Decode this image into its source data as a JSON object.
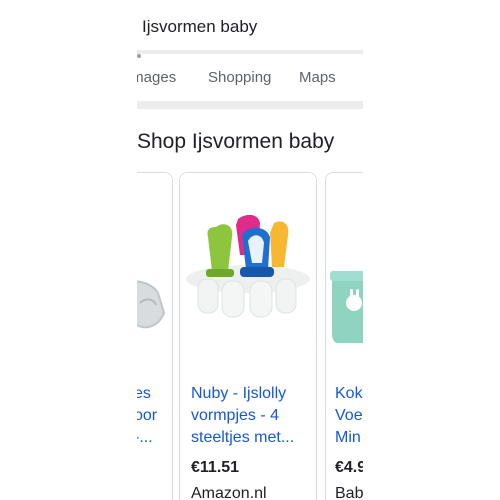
{
  "search": {
    "query": "Ijsvormen baby"
  },
  "tabs": [
    {
      "label": "Images"
    },
    {
      "label": "Shopping"
    },
    {
      "label": "Maps"
    }
  ],
  "section": {
    "title": "Shop Ijsvormen baby"
  },
  "products": [
    {
      "title_lines": [
        "es",
        "oor",
        "-..."
      ]
    },
    {
      "title_lines": [
        "Nuby - Ijslolly",
        "vormpjes - 4",
        "steeltjes met..."
      ],
      "price": "€11.51",
      "store": "Amazon.nl"
    },
    {
      "title_lines": [
        "Kok",
        "Voe",
        "Min"
      ],
      "price": "€4.9",
      "store": "Bab"
    }
  ]
}
